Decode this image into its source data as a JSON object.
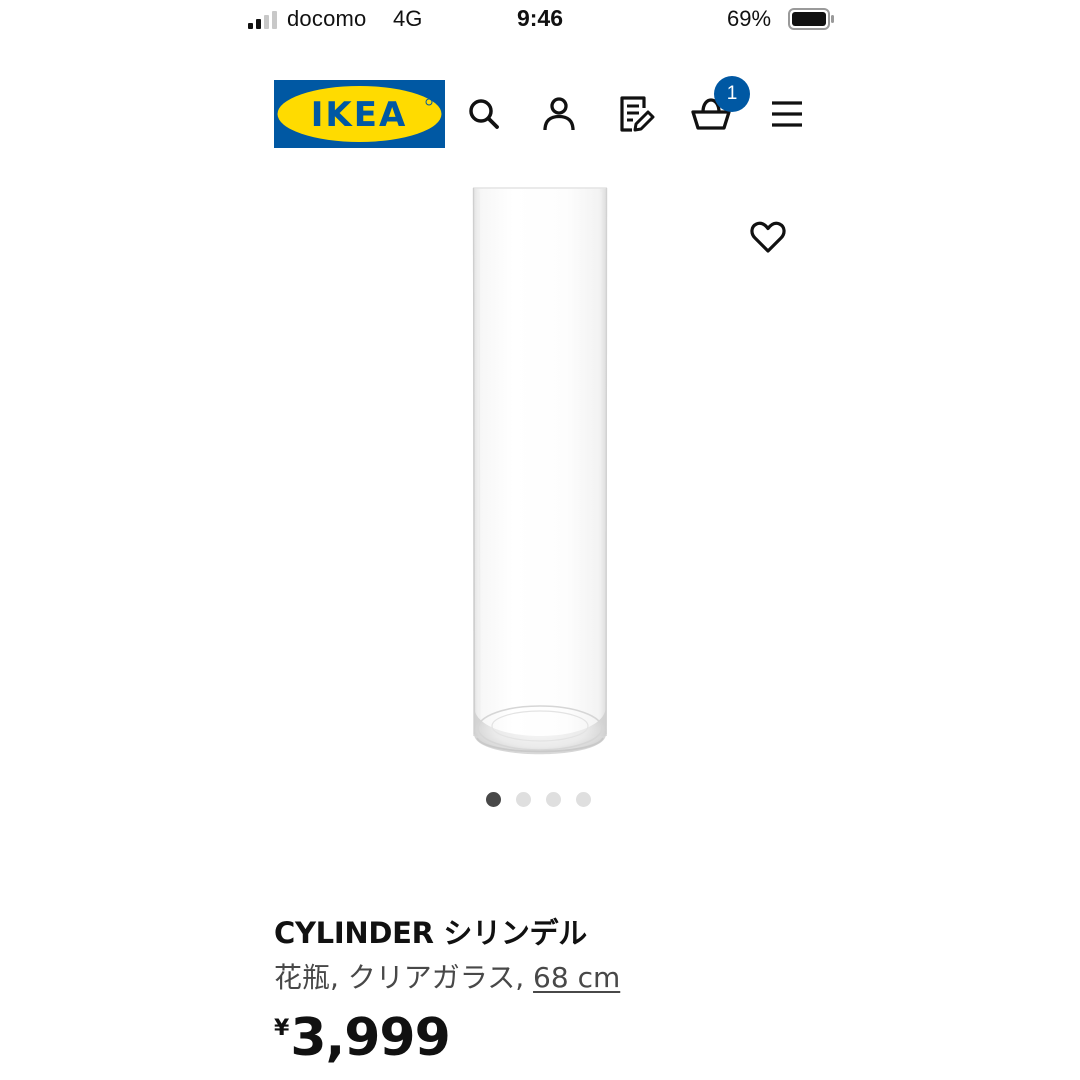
{
  "status_bar": {
    "carrier": "docomo",
    "network": "4G",
    "time": "9:46",
    "battery_percent": "69%",
    "battery_level": 0.69
  },
  "header": {
    "logo_text": "IKEA",
    "brand_colors": {
      "blue": "#0058a3",
      "yellow": "#ffdb00"
    },
    "icons": [
      "search-icon",
      "account-icon",
      "shopping-list-icon",
      "basket-icon",
      "menu-icon"
    ],
    "cart_count": "1"
  },
  "gallery": {
    "image_count": 4,
    "active_index": 0,
    "favorite_icon": "heart-icon"
  },
  "product": {
    "name": "CYLINDER シリンデル",
    "description": "花瓶, クリアガラス, ",
    "size": "68 cm",
    "currency": "¥",
    "price": "3,999"
  }
}
